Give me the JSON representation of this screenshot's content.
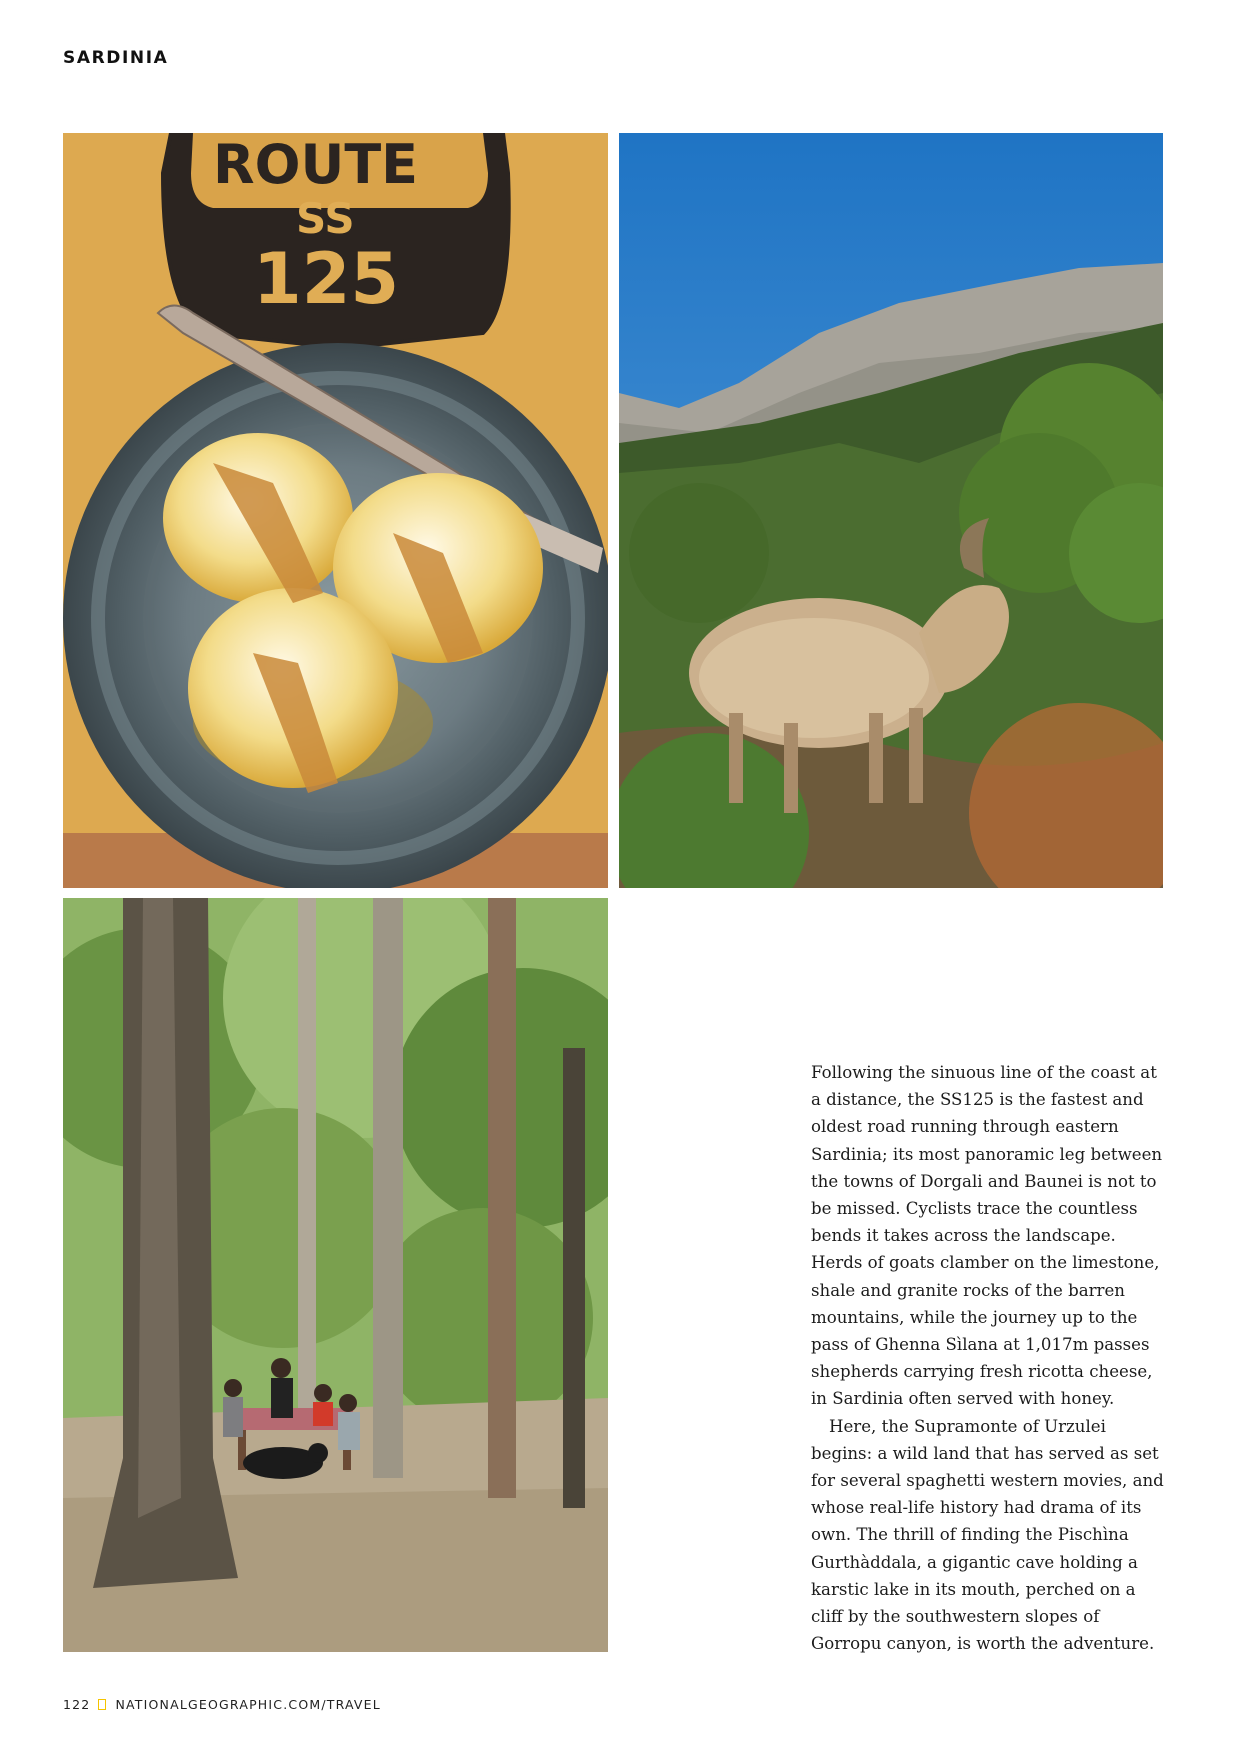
{
  "header": {
    "section": "SARDINIA"
  },
  "photos": {
    "food": {
      "sign_line1": "ROUTE",
      "sign_line2": "SS",
      "sign_line3": "125"
    },
    "goat": {},
    "forest": {}
  },
  "article": {
    "paragraphs": [
      "Following the sinuous line of the coast at a distance, the SS125 is the fastest and oldest road running through eastern Sardinia; its most panoramic leg between the towns of Dorgali and Baunei is not to be missed. Cyclists trace the countless bends it takes across the landscape. Herds of goats clamber on the limestone, shale and granite rocks of the barren mountains, while the journey up to the pass of Ghenna Sìlana at 1,017m passes shepherds carrying fresh ricotta cheese, in Sardinia often served with honey.",
      "Here, the Supramonte of Urzulei begins: a wild land that has served as set for several spaghetti western movies, and whose real-life history had drama of its own. The thrill of finding the Pischìna Gurthàddala, a gigantic cave holding a karstic lake in its mouth, perched on a cliff by the southwestern slopes of Gorropu canyon, is worth the adventure."
    ]
  },
  "footer": {
    "page_number": "122",
    "url": "NATIONALGEOGRAPHIC.COM/TRAVEL"
  }
}
